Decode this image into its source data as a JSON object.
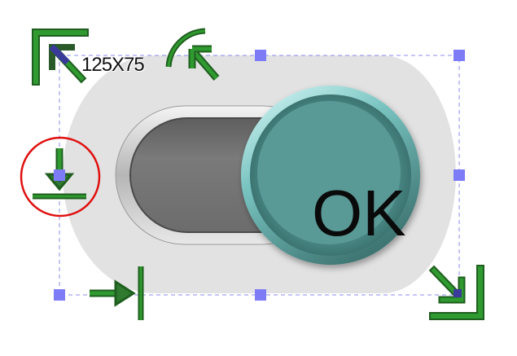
{
  "selection": {
    "size_label": "125X75"
  },
  "toggle": {
    "state_label": "OK",
    "track_color": "#777777",
    "knob_color": "#5a9a96",
    "knob_highlight": "#a9e2e0",
    "background_color": "#e2e2e2"
  },
  "tools": {
    "accent_color": "#2a8a2a",
    "handle_color": "#7d7cf6",
    "circle_color": "#e01010",
    "icons": [
      "resize-top-left-icon",
      "rotate-icon",
      "align-bottom-icon",
      "align-right-icon",
      "resize-bottom-right-icon"
    ]
  }
}
